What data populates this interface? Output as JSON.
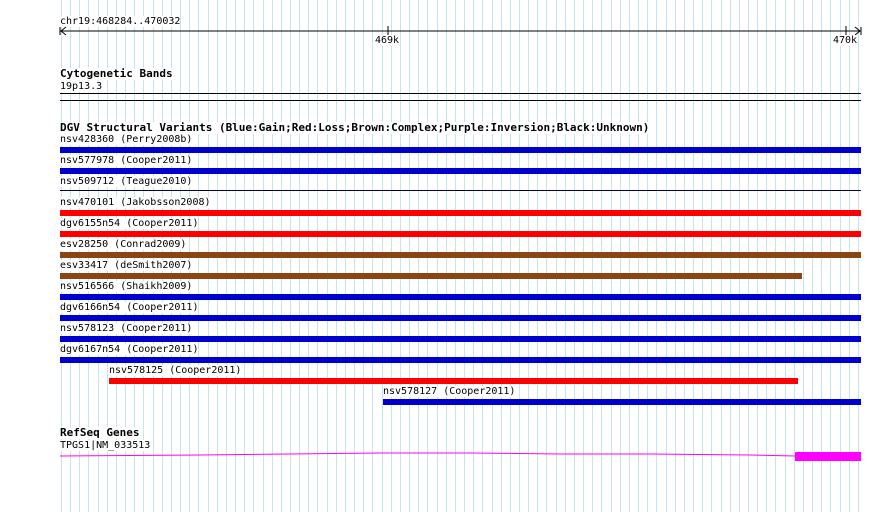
{
  "position": "chr19:468284..470032",
  "ruler": {
    "ticks": [
      "469k",
      "470k"
    ]
  },
  "tracks": {
    "cytoband": {
      "title": "Cytogenetic Bands",
      "band": "19p13.3"
    },
    "dgv": {
      "title": "DGV Structural Variants (Blue:Gain;Red:Loss;Brown:Complex;Purple:Inversion;Black:Unknown)",
      "features": [
        {
          "label": "nsv428360 (Perry2008b)",
          "type": "Gain",
          "color": "#0000cc"
        },
        {
          "label": "nsv577978 (Cooper2011)",
          "type": "Gain",
          "color": "#0000cc"
        },
        {
          "label": "nsv509712 (Teague2010)",
          "type": "Unknown",
          "color": "#000033"
        },
        {
          "label": "nsv470101 (Jakobsson2008)",
          "type": "Loss",
          "color": "#ff0000"
        },
        {
          "label": "dgv6155n54 (Cooper2011)",
          "type": "Loss",
          "color": "#ff0000"
        },
        {
          "label": "esv28250 (Conrad2009)",
          "type": "Complex",
          "color": "#8b4513"
        },
        {
          "label": "esv33417 (deSmith2007)",
          "type": "Complex",
          "color": "#8b4513"
        },
        {
          "label": "nsv516566 (Shaikh2009)",
          "type": "Gain",
          "color": "#0000cc"
        },
        {
          "label": "dgv6166n54 (Cooper2011)",
          "type": "Gain",
          "color": "#0000cc"
        },
        {
          "label": "nsv578123 (Cooper2011)",
          "type": "Gain",
          "color": "#0000cc"
        },
        {
          "label": "dgv6167n54 (Cooper2011)",
          "type": "Gain",
          "color": "#0000cc"
        },
        {
          "label": "nsv578125 (Cooper2011)",
          "type": "Loss",
          "color": "#ff0000"
        },
        {
          "label": "nsv578127 (Cooper2011)",
          "type": "Gain",
          "color": "#0000cc"
        }
      ]
    },
    "refseq": {
      "title": "RefSeq Genes",
      "gene": "TPGS1|NM_033513",
      "color": "#ff00ff"
    }
  }
}
